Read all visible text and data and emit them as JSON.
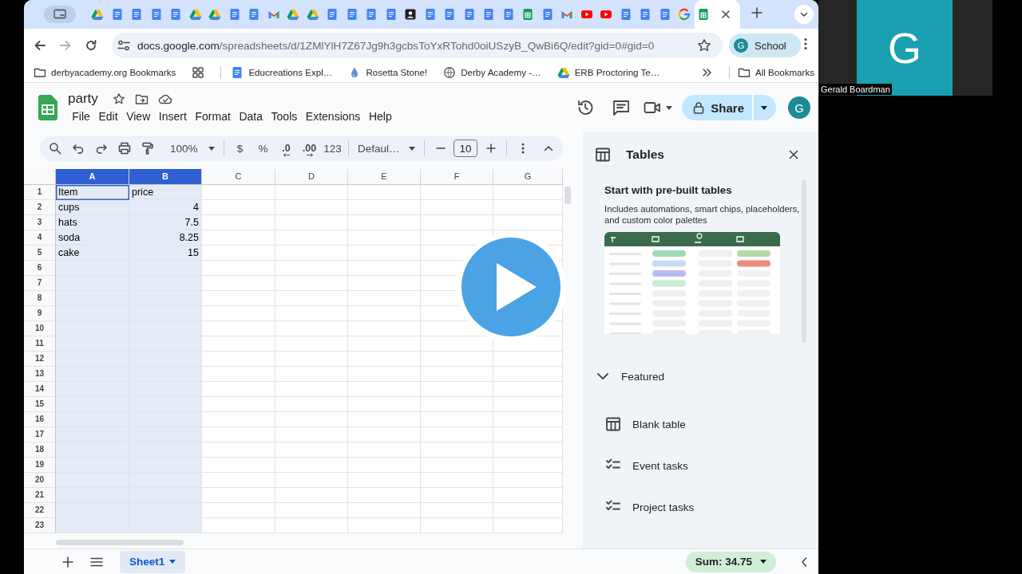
{
  "browser": {
    "tabs": [
      {
        "kind": "drive",
        "selected": false
      },
      {
        "kind": "docs",
        "selected": false
      },
      {
        "kind": "docs",
        "selected": false
      },
      {
        "kind": "docs",
        "selected": false
      },
      {
        "kind": "docs",
        "selected": false
      },
      {
        "kind": "drive",
        "selected": false
      },
      {
        "kind": "drive",
        "selected": false
      },
      {
        "kind": "docs",
        "selected": false
      },
      {
        "kind": "docs",
        "selected": false
      },
      {
        "kind": "gmail",
        "selected": false
      },
      {
        "kind": "drive",
        "selected": false
      },
      {
        "kind": "drive",
        "selected": false
      },
      {
        "kind": "docs",
        "selected": false
      },
      {
        "kind": "docs",
        "selected": false
      },
      {
        "kind": "docs",
        "selected": false
      },
      {
        "kind": "docs",
        "selected": false
      },
      {
        "kind": "contact",
        "selected": false
      },
      {
        "kind": "docs",
        "selected": false
      },
      {
        "kind": "docs",
        "selected": false
      },
      {
        "kind": "docs",
        "selected": false
      },
      {
        "kind": "docs",
        "selected": false
      },
      {
        "kind": "docs",
        "selected": false
      },
      {
        "kind": "sheets",
        "selected": false
      },
      {
        "kind": "docs",
        "selected": false
      },
      {
        "kind": "gmail",
        "selected": false
      },
      {
        "kind": "youtube",
        "selected": false
      },
      {
        "kind": "youtube",
        "selected": false
      },
      {
        "kind": "docs",
        "selected": false
      },
      {
        "kind": "docs",
        "selected": false
      },
      {
        "kind": "docs",
        "selected": false
      },
      {
        "kind": "google",
        "selected": false
      },
      {
        "kind": "sheets",
        "selected": true
      }
    ],
    "url_host": "docs.google.com",
    "url_path": "/spreadsheets/d/1ZMlYlH7Z67Jg9h3gcbsToYxRTohd0oiUSzyB_QwBi6Q/edit?gid=0#gid=0",
    "profile": {
      "initial": "G",
      "label": "School"
    },
    "bookmarks": [
      {
        "kind": "folder",
        "label": "derbyacademy.org Bookmarks"
      },
      {
        "kind": "apps"
      },
      {
        "kind": "docs",
        "label": "Educreations Expl…"
      },
      {
        "kind": "drop",
        "label": "Rosetta Stone!"
      },
      {
        "kind": "globe",
        "label": "Derby Academy -…"
      },
      {
        "kind": "drive",
        "label": "ERB Proctoring Te…"
      }
    ],
    "all_bookmarks": "All Bookmarks"
  },
  "sheet": {
    "title": "party",
    "menu": [
      "File",
      "Edit",
      "View",
      "Insert",
      "Format",
      "Data",
      "Tools",
      "Extensions",
      "Help"
    ],
    "share": "Share",
    "avatar": "G",
    "zoom": "100%",
    "format_buttons": [
      {
        "kind": "plain",
        "label": "$"
      },
      {
        "kind": "plain",
        "label": "%"
      },
      {
        "kind": "decrease",
        "label": ".0"
      },
      {
        "kind": "increase",
        "label": ".00"
      },
      {
        "kind": "plain",
        "label": "123"
      }
    ],
    "font": "Defaul…",
    "font_size": "10",
    "columns": [
      {
        "label": "A",
        "selected": true
      },
      {
        "label": "B",
        "selected": true
      },
      {
        "label": "C",
        "selected": false
      },
      {
        "label": "D",
        "selected": false
      },
      {
        "label": "E",
        "selected": false
      },
      {
        "label": "F",
        "selected": false
      },
      {
        "label": "G",
        "selected": false
      }
    ],
    "rows": [
      {
        "number": "1",
        "cells": [
          {
            "text": "Item",
            "kind": "text",
            "active": true
          },
          {
            "text": "price",
            "kind": "text",
            "active": false
          }
        ]
      },
      {
        "number": "2",
        "cells": [
          {
            "text": "cups",
            "kind": "text",
            "active": false
          },
          {
            "text": "4",
            "kind": "number",
            "active": false
          }
        ]
      },
      {
        "number": "3",
        "cells": [
          {
            "text": "hats",
            "kind": "text",
            "active": false
          },
          {
            "text": "7.5",
            "kind": "number",
            "active": false
          }
        ]
      },
      {
        "number": "4",
        "cells": [
          {
            "text": "soda",
            "kind": "text",
            "active": false
          },
          {
            "text": "8.25",
            "kind": "number",
            "active": false
          }
        ]
      },
      {
        "number": "5",
        "cells": [
          {
            "text": "cake",
            "kind": "text",
            "active": false
          },
          {
            "text": "15",
            "kind": "number",
            "active": false
          }
        ]
      },
      {
        "number": "6"
      },
      {
        "number": "7"
      },
      {
        "number": "8"
      },
      {
        "number": "9"
      },
      {
        "number": "10"
      },
      {
        "number": "11"
      },
      {
        "number": "12"
      },
      {
        "number": "13"
      },
      {
        "number": "14"
      },
      {
        "number": "15"
      },
      {
        "number": "16"
      },
      {
        "number": "17"
      },
      {
        "number": "18"
      },
      {
        "number": "19"
      },
      {
        "number": "20"
      },
      {
        "number": "21"
      },
      {
        "number": "22"
      },
      {
        "number": "23"
      }
    ],
    "sheet_tabs": [
      {
        "name": "Sheet1",
        "selected": true
      }
    ],
    "sum": "Sum: 34.75"
  },
  "tables_panel": {
    "title": "Tables",
    "card_title": "Start with pre-built tables",
    "card_text": "Includes automations, smart chips, placeholders, and custom color palettes",
    "section": {
      "title": "Featured",
      "expanded": true
    },
    "items": [
      {
        "kind": "blank",
        "label": "Blank table"
      },
      {
        "kind": "checklist",
        "label": "Event tasks"
      },
      {
        "kind": "checklist",
        "label": "Project tasks"
      }
    ]
  },
  "video": {
    "initial": "G",
    "name": "Gerald Boardman"
  }
}
